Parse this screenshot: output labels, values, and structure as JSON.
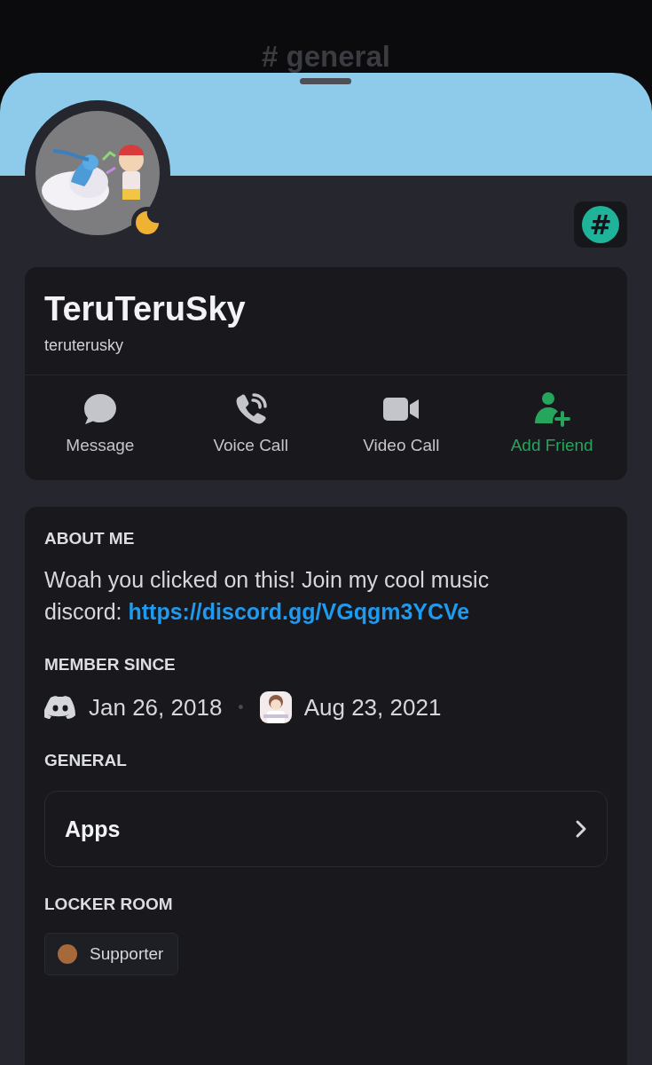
{
  "channel_title": "# general",
  "profile": {
    "idle": true,
    "badge": "#",
    "display_name": "TeruTeruSky",
    "username": "teruterusky",
    "actions": [
      {
        "kind": "message",
        "label": "Message",
        "highlighted": false
      },
      {
        "kind": "voice",
        "label": "Voice Call",
        "highlighted": false
      },
      {
        "kind": "video",
        "label": "Video Call",
        "highlighted": false
      },
      {
        "kind": "add_friend",
        "label": "Add Friend",
        "highlighted": true
      }
    ]
  },
  "about_me": {
    "heading": "ABOUT ME",
    "text": "Woah you clicked on this! Join my cool music discord: ",
    "link": "https://discord.gg/VGqgm3YCVe"
  },
  "member_since": {
    "heading": "MEMBER SINCE",
    "separator": "•",
    "dates": [
      {
        "kind": "app",
        "date": "Jan 26, 2018"
      },
      {
        "kind": "server",
        "date": "Aug 23, 2021"
      }
    ]
  },
  "general": {
    "heading": "GENERAL",
    "items": [
      {
        "label": "Apps"
      }
    ]
  },
  "locker_room": {
    "heading": "LOCKER ROOM",
    "tags": [
      {
        "label": "Supporter",
        "color": "#a5693a"
      }
    ]
  }
}
